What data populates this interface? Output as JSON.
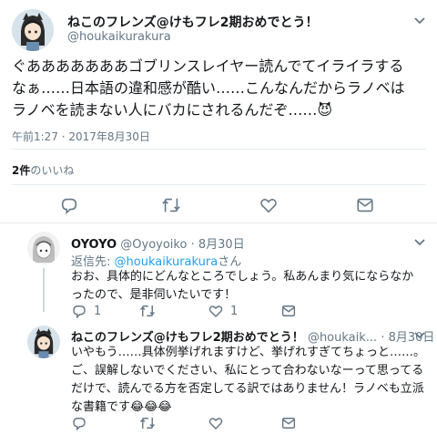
{
  "main_tweet": {
    "display_name": "ねこのフレンズ@けもフレ2期おめでとう！",
    "handle": "@houkaikurakura",
    "text": "ぐあああああああゴブリンスレイヤー読んでてイライラするなぁ……日本語の違和感が酷い……こんなんだからラノベはラノベを読まない人にバカにされるんだぞ……😈",
    "timestamp": "午前1:27 · 2017年8月30日",
    "likes_count": "2件",
    "likes_label": "のいいね",
    "icons": [
      "reply-icon",
      "retweet-icon",
      "like-icon",
      "dm-icon"
    ]
  },
  "reply1": {
    "display_name": "OYOYO",
    "handle": "@Oyoyoiko",
    "sep": "·",
    "date": "8月30日",
    "reply_prefix": "返信先: ",
    "reply_to": "@houkaikurakura",
    "reply_suffix": "さん",
    "text": "おお、具体的にどんなところでしょう。私あんまり気にならなかったので、是非伺いたいです！",
    "reply_count": "1",
    "like_count": "1"
  },
  "reply2": {
    "display_name": "ねこのフレンズ@けもフレ2期おめでとう！",
    "handle": "@houkaik...",
    "sep": "·",
    "date": "8月30日",
    "text": "いやもう……具体例挙げれますけど、挙げれすぎてちょっと……。ご、誤解しないでください、私にとって合わないなーって思ってるだけで、読んでる方を否定してる訳ではありません！ラノベも立派な書籍です😂😂😂"
  },
  "colors": {
    "text": "#14171a",
    "muted": "#657786",
    "link": "#1da1f2",
    "divider": "#e6ecf0"
  }
}
